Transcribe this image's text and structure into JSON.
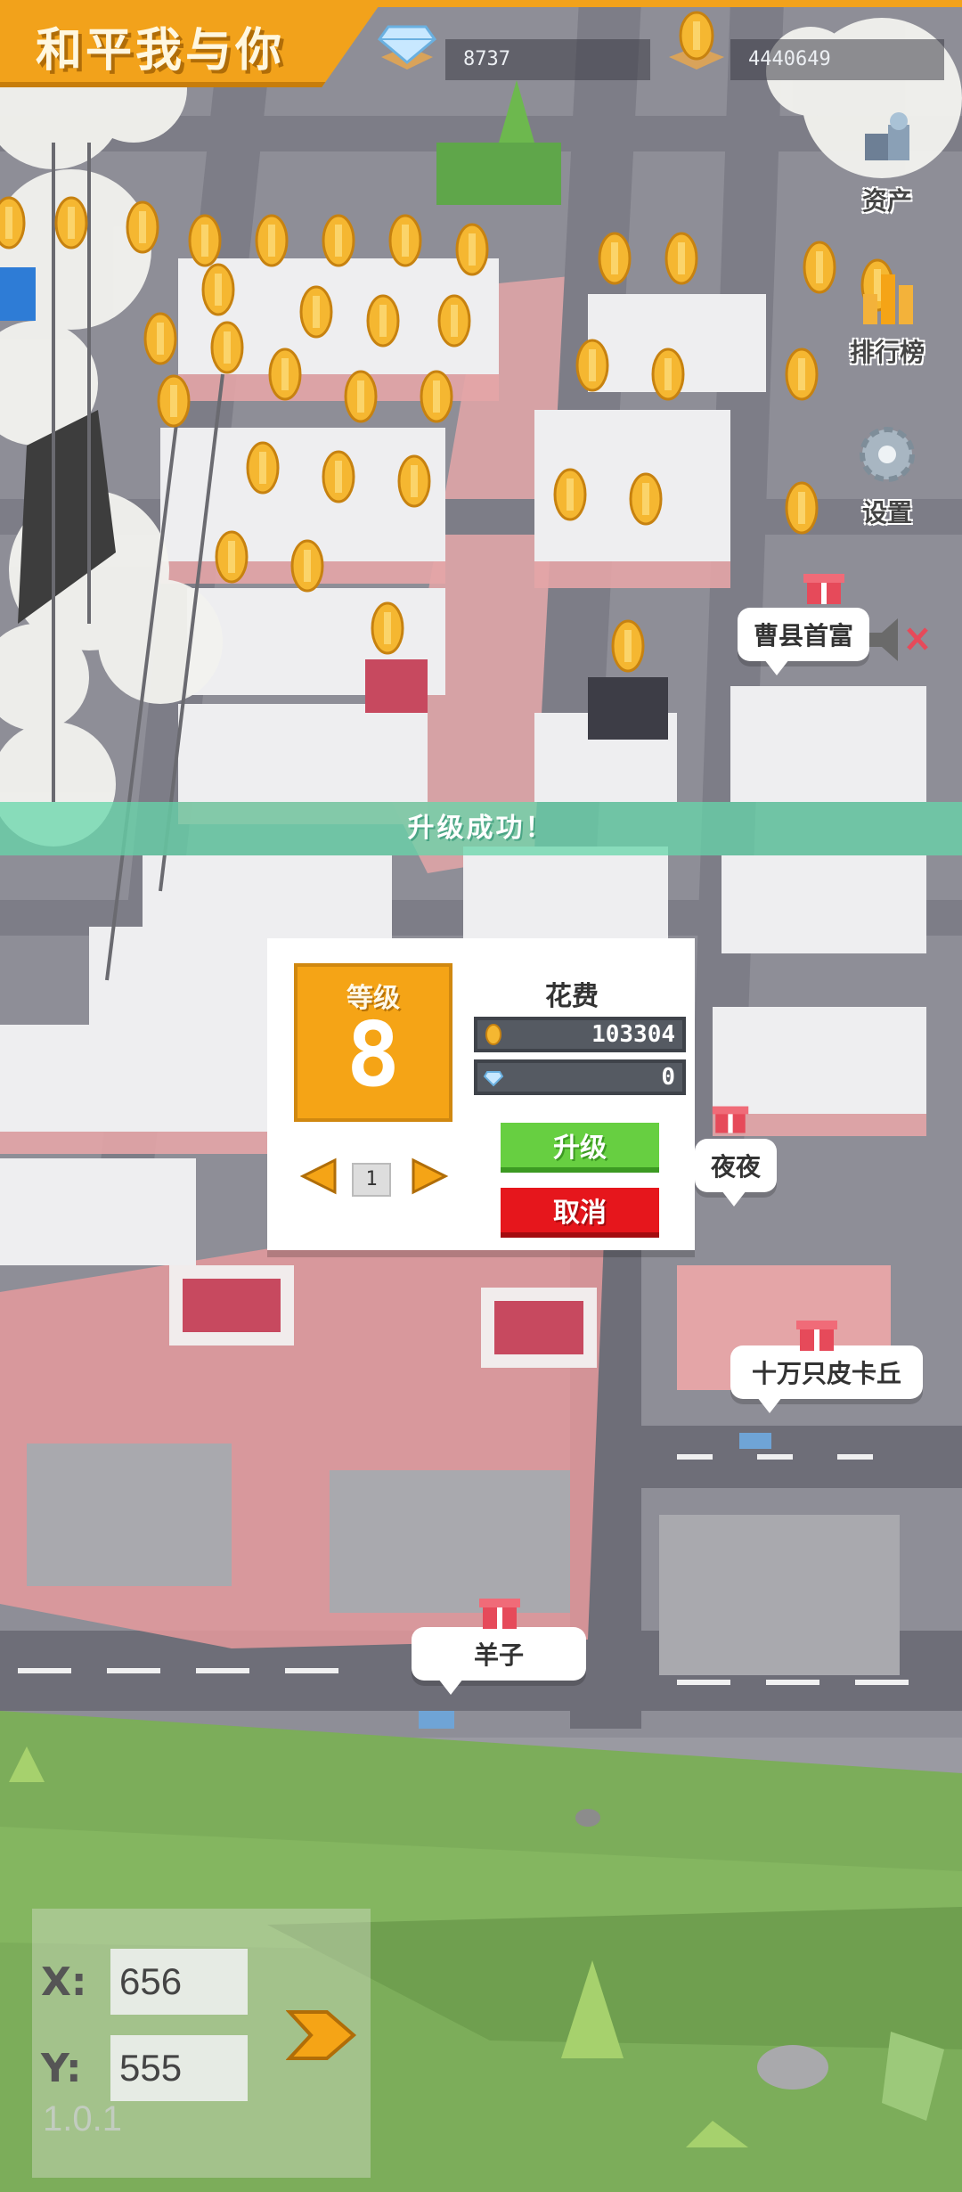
{
  "header": {
    "title": "和平我与你",
    "gems_value": "8737",
    "coins_value": "4440649"
  },
  "side_menu": {
    "assets_label": "资产",
    "ranking_label": "排行榜",
    "settings_label": "设置"
  },
  "map_labels": {
    "cao_county": "曹县首富",
    "yeye": "夜夜",
    "hundred_thousand": "十万只皮卡丘",
    "yangzi": "羊子"
  },
  "success_message": "升级成功！",
  "upgrade_dialog": {
    "level_label": "等级",
    "level_value": "8",
    "cost_title": "花费",
    "cost_coins": "103304",
    "cost_gems": "0",
    "quantity": "1",
    "upgrade_button": "升级",
    "cancel_button": "取消"
  },
  "coordinates": {
    "x_label": "X:",
    "x_value": "656",
    "y_label": "Y:",
    "y_value": "555"
  },
  "version": "1.0.1",
  "colors": {
    "accent_orange": "#f2a21b",
    "upgrade_green": "#67cf41",
    "cancel_red": "#e6161c",
    "success_teal": "#66d6aa",
    "grass_green": "#7cad5a"
  },
  "icons": [
    "diamond-icon",
    "coin-icon",
    "assets-icon",
    "ranking-icon",
    "gear-icon",
    "gift-icon",
    "speaker-muted-icon",
    "arrow-left-icon",
    "arrow-right-icon",
    "go-arrow-icon"
  ]
}
